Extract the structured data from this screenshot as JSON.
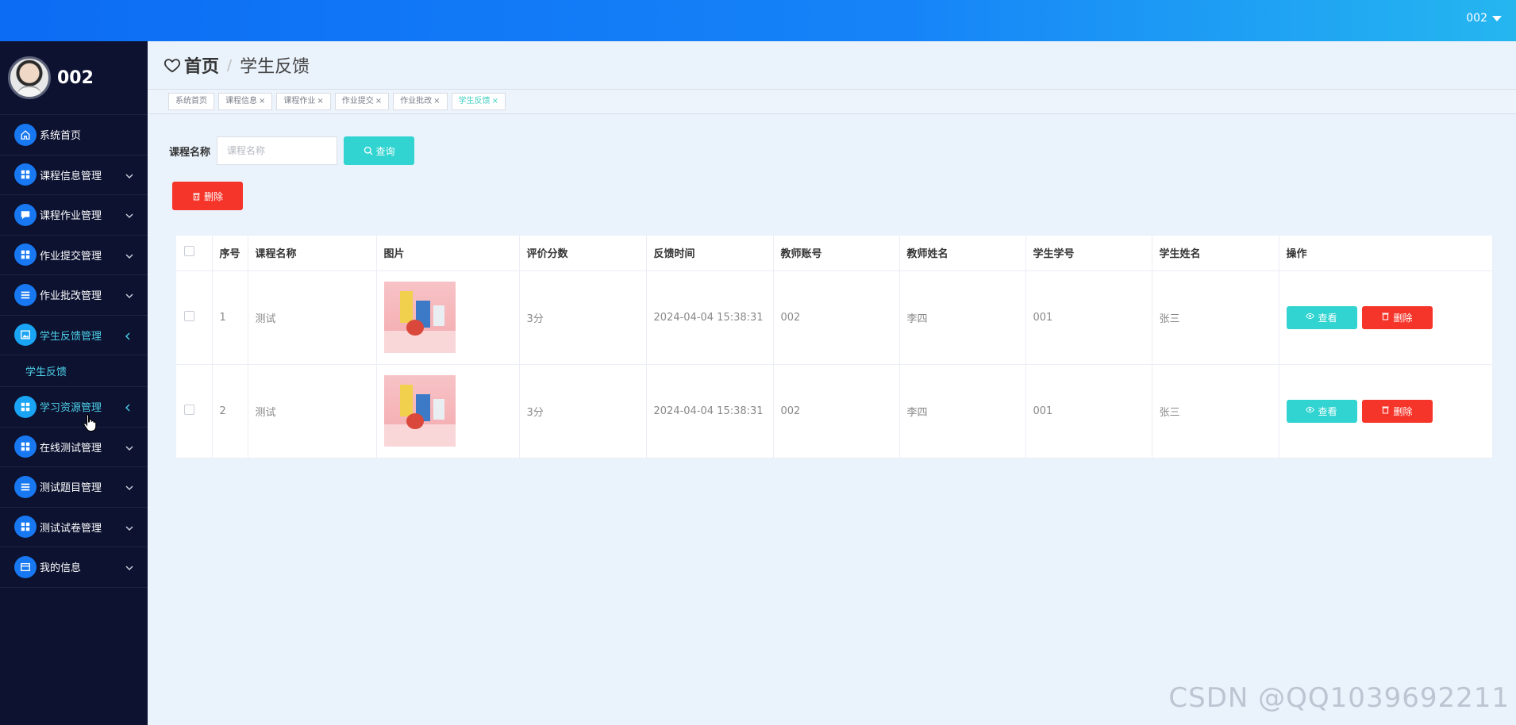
{
  "topbar": {
    "user_label": "002"
  },
  "sidebar": {
    "profile_name": "002",
    "items": [
      {
        "label": "系统首页",
        "icon": "home-icon",
        "has_arrow": false
      },
      {
        "label": "课程信息管理",
        "icon": "grid-icon",
        "has_arrow": true
      },
      {
        "label": "课程作业管理",
        "icon": "chat-icon",
        "has_arrow": true
      },
      {
        "label": "作业提交管理",
        "icon": "grid-icon",
        "has_arrow": true
      },
      {
        "label": "作业批改管理",
        "icon": "list-icon",
        "has_arrow": true
      },
      {
        "label": "学生反馈管理",
        "icon": "image-icon",
        "has_arrow": true,
        "active": true
      },
      {
        "label": "学习资源管理",
        "icon": "grid-icon",
        "has_arrow": true
      },
      {
        "label": "在线测试管理",
        "icon": "grid-icon",
        "has_arrow": true
      },
      {
        "label": "测试题目管理",
        "icon": "list-icon",
        "has_arrow": true
      },
      {
        "label": "测试试卷管理",
        "icon": "grid-icon",
        "has_arrow": true
      },
      {
        "label": "我的信息",
        "icon": "card-icon",
        "has_arrow": true
      }
    ],
    "submenu": {
      "label": "学生反馈"
    }
  },
  "breadcrumb": {
    "home": "首页",
    "separator": "/",
    "current": "学生反馈"
  },
  "tags": [
    {
      "label": "系统首页",
      "closable": false
    },
    {
      "label": "课程信息",
      "closable": true
    },
    {
      "label": "课程作业",
      "closable": true
    },
    {
      "label": "作业提交",
      "closable": true
    },
    {
      "label": "作业批改",
      "closable": true
    },
    {
      "label": "学生反馈",
      "closable": true,
      "active": true
    }
  ],
  "search": {
    "label": "课程名称",
    "placeholder": "课程名称",
    "button_label": "查询"
  },
  "actions": {
    "delete_label": "删除"
  },
  "table": {
    "headers": [
      "",
      "序号",
      "课程名称",
      "图片",
      "评价分数",
      "反馈时间",
      "教师账号",
      "教师姓名",
      "学生学号",
      "学生姓名",
      "操作"
    ],
    "rows": [
      {
        "index": "1",
        "course": "测试",
        "score": "3分",
        "time": "2024-04-04 15:38:31",
        "teacher_account": "002",
        "teacher_name": "李四",
        "student_id": "001",
        "student_name": "张三"
      },
      {
        "index": "2",
        "course": "测试",
        "score": "3分",
        "time": "2024-04-04 15:38:31",
        "teacher_account": "002",
        "teacher_name": "李四",
        "student_id": "001",
        "student_name": "张三"
      }
    ],
    "view_label": "查看",
    "delete_label": "删除"
  },
  "watermark": "CSDN @QQ1039692211",
  "colors": {
    "accent": "#31d4d0",
    "danger": "#f5352a",
    "sidebar": "#0c1230",
    "topbar": "#1684f8"
  }
}
